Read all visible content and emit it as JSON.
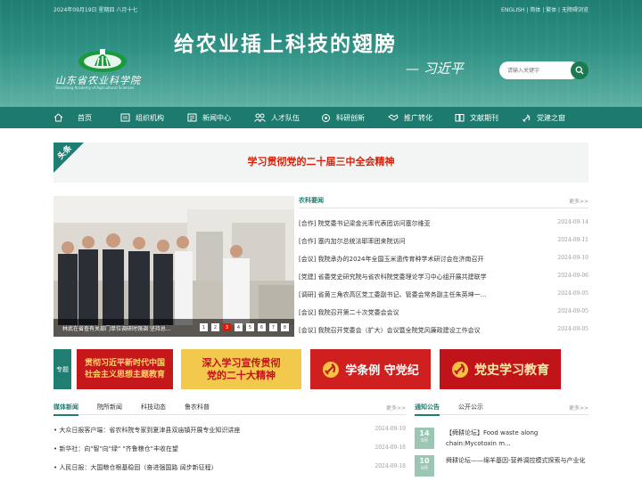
{
  "topbar": {
    "date": "2024年09月19日 星期四 八月十七",
    "links": [
      "ENGLISH",
      "简体",
      "繁体",
      "无障碍浏览"
    ],
    "separator": " | "
  },
  "logo": {
    "name_cn": "山东省农业科学院",
    "name_en": "Shandong Academy of Agricultural Sciences"
  },
  "banner": {
    "slogan": "给农业插上科技的翅膀",
    "signature": "— 习近平"
  },
  "search": {
    "placeholder": "请输入关键字"
  },
  "nav": {
    "items": [
      {
        "label": "首页",
        "icon": "home-icon"
      },
      {
        "label": "组织机构",
        "icon": "org-icon"
      },
      {
        "label": "新闻中心",
        "icon": "news-icon"
      },
      {
        "label": "人才队伍",
        "icon": "people-icon"
      },
      {
        "label": "科研创新",
        "icon": "research-icon"
      },
      {
        "label": "推广转化",
        "icon": "handshake-icon"
      },
      {
        "label": "文献期刊",
        "icon": "book-icon"
      },
      {
        "label": "党建之窗",
        "icon": "party-icon"
      }
    ]
  },
  "headline": {
    "badge": "头条",
    "text": "学习贯彻党的二十届三中全会精神"
  },
  "slider": {
    "caption": "林武在省查有关部门单位调研时强调 坚持总...",
    "dots": [
      "1",
      "2",
      "3",
      "4",
      "5",
      "6",
      "7",
      "8"
    ],
    "active_dot": 2
  },
  "agri_news": {
    "title": "农科要闻",
    "more": "更多>>",
    "items": [
      {
        "title": "[合作] 院党委书记梁金光率代表团访问塞尔维亚",
        "date": "2024-09-14"
      },
      {
        "title": "[合作] 塞内加尔总统法耶率团来院访问",
        "date": "2024-09-11"
      },
      {
        "title": "[会议] 我院承办的2024年全国玉米遗传育种学术研讨会在济南召开",
        "date": "2024-09-10"
      },
      {
        "title": "[党建] 省委党史研究院与省农科院党委理论学习中心组开展共建联学",
        "date": "2024-09-06"
      },
      {
        "title": "[调研] 省黄三角农高区党工委副书记、管委会常务副主任朱英坤一...",
        "date": "2024-09-05"
      },
      {
        "title": "[会议] 我院召开第二十次党委会会议",
        "date": "2024-09-05"
      },
      {
        "title": "[会议] 我院召开党委会（扩大）会议暨全院党风廉政建设工作会议",
        "date": "2024-09-05"
      }
    ]
  },
  "topics": {
    "label": "专题",
    "banners": [
      {
        "text": "贯彻习近平新时代中国特色社会主义思想主题教育",
        "line1": "贯彻习近平新时代中国",
        "line2": "社会主义思想主题教育",
        "bg": "#c6171b",
        "fg": "#ffd76a"
      },
      {
        "text": "深入学习宣传贯彻党的二十大精神",
        "line1": "深入学习宣传贯彻",
        "line2": "党的二十大精神",
        "bg": "#f2c94c",
        "fg": "#c0141a"
      },
      {
        "text": "学条例 守党纪",
        "line1": "学条例 守党纪",
        "line2": "",
        "bg": "#cf1f1f",
        "fg": "#ffffff"
      },
      {
        "text": "党史学习教育",
        "line1": "党史学习教育",
        "line2": "",
        "bg": "#c0141a",
        "fg": "#ffe9a8"
      }
    ]
  },
  "media": {
    "tabs": [
      "媒体新闻",
      "院所新闻",
      "科技动态",
      "鲁农科普"
    ],
    "more": "更多>>",
    "items": [
      {
        "title": "• 大众日报客户端：省农科院专家到夏津县双庙镇开展专业知识讲座",
        "date": "2024-09-19"
      },
      {
        "title": "• 新华社：向\"智\"向\"绿\" \"齐鲁粮仓\"丰收在望",
        "date": "2024-09-18"
      },
      {
        "title": "• 人民日报：大国粮仓根基稳固（奋进强国路 阔步新征程）",
        "date": "2024-09-18"
      }
    ]
  },
  "notices": {
    "tabs": [
      "通知公告",
      "公开公示"
    ],
    "more": "更多>>",
    "items": [
      {
        "day": "14",
        "month": "9月",
        "title": "【舜耕论坛】Food waste along chain:Mycotoxin m..."
      },
      {
        "day": "10",
        "month": "9月",
        "title": "舜耕论坛——绵羊基因-营养调控模式探索与产业化"
      }
    ]
  },
  "colors": {
    "primary": "#1f7d72",
    "nav": "#1d7a6e",
    "accent_red": "#d81e06"
  }
}
